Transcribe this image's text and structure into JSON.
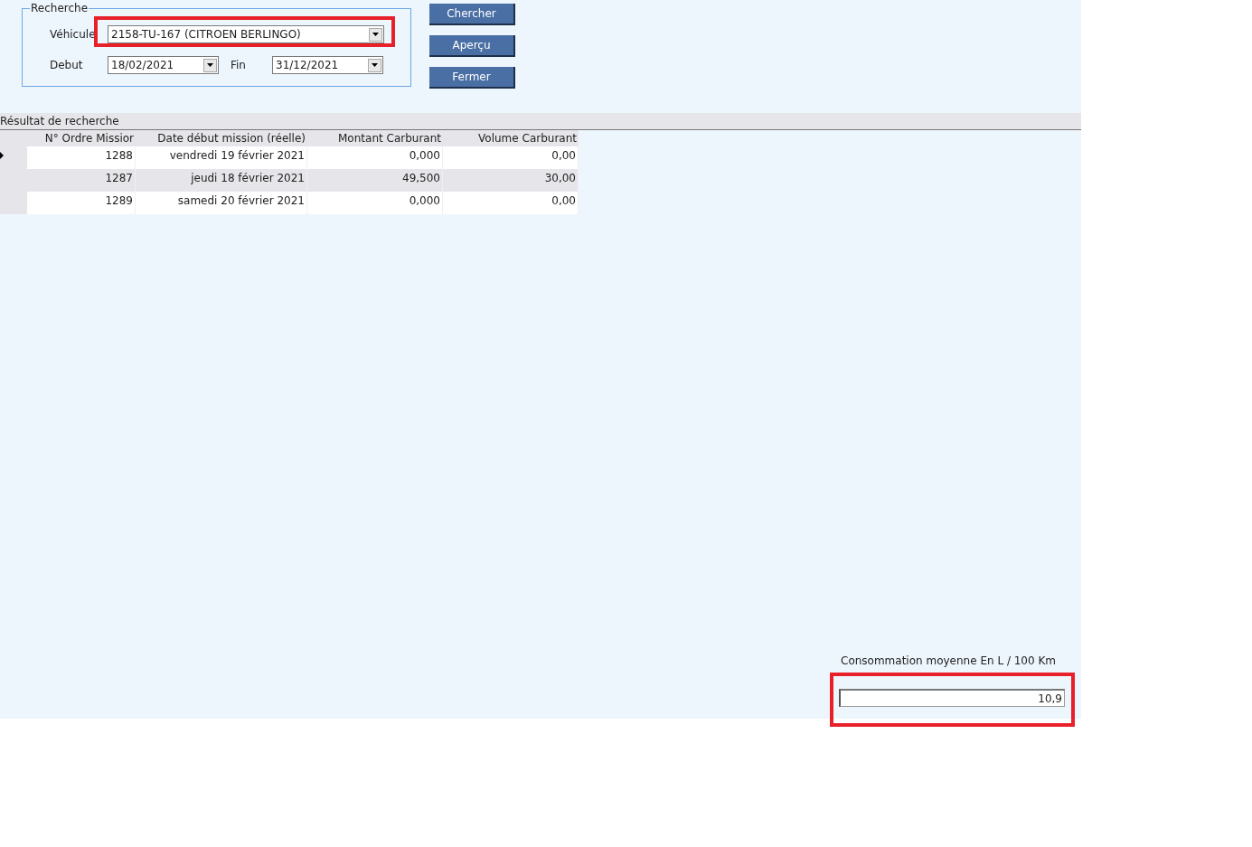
{
  "search": {
    "title": "Recherche",
    "vehicle": {
      "label": "Véhicule",
      "value": "2158-TU-167 (CITROEN BERLINGO)"
    },
    "start": {
      "label": "Debut",
      "value": "18/02/2021"
    },
    "end": {
      "label": "Fin",
      "value": "31/12/2021"
    }
  },
  "buttons": [
    "Chercher",
    "Aperçu",
    "Fermer"
  ],
  "results": {
    "title": "Résultat de recherche",
    "columns": [
      "N° Ordre Missior",
      "Date début mission (réelle)",
      "Montant Carburant",
      "Volume Carburant"
    ],
    "rows": [
      {
        "cells": [
          "1288",
          "vendredi 19 février 2021",
          "0,000",
          "0,00"
        ],
        "selected": true
      },
      {
        "cells": [
          "1287",
          "jeudi 18 février 2021",
          "49,500",
          "30,00"
        ],
        "selected": false
      },
      {
        "cells": [
          "1289",
          "samedi 20 février 2021",
          "0,000",
          "0,00"
        ],
        "selected": false
      }
    ]
  },
  "consumption": {
    "label": "Consommation moyenne En L / 100 Km",
    "value": "10,9"
  }
}
